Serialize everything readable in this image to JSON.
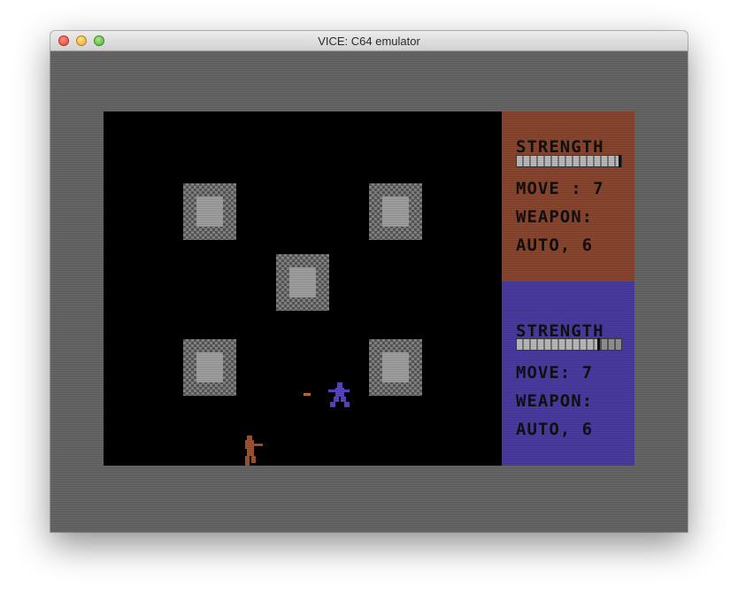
{
  "window": {
    "title": "VICE: C64 emulator"
  },
  "colors": {
    "border": "#6b6b6b",
    "playfield": "#000000",
    "player1_panel": "#8b4a34",
    "player2_panel": "#4d3fa0",
    "pillar_light": "#a7a7a7",
    "player1_sprite": "#a0583a",
    "player2_sprite": "#5a49c0",
    "bullet": "#c2703a"
  },
  "player1": {
    "strength_label": "STRENGTH",
    "strength_level": 1.0,
    "move_text": "MOVE : 7",
    "weapon_label": "WEAPON:",
    "weapon_value": "AUTO, 6"
  },
  "player2": {
    "strength_label": "STRENGTH",
    "strength_level": 0.8,
    "move_text": "MOVE: 7",
    "weapon_label": "WEAPON:",
    "weapon_value": "AUTO, 6"
  },
  "icons": {
    "close": "close-button-icon",
    "minimize": "minimize-button-icon",
    "zoom": "zoom-button-icon",
    "player1": "gunman-sprite-icon",
    "player2": "gunman-sprite-icon",
    "pillar": "checkered-pillar-icon",
    "bullet": "bullet-icon"
  }
}
